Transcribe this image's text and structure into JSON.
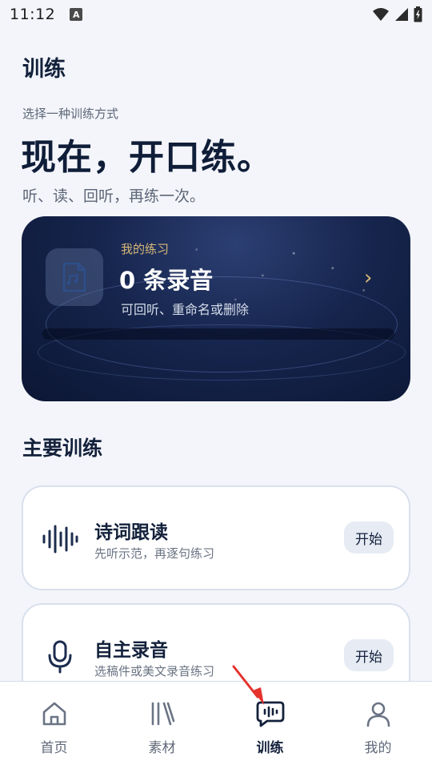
{
  "status": {
    "time": "11:12",
    "badge": "A"
  },
  "page": {
    "title": "训练",
    "subtitle": "选择一种训练方式",
    "headline": "现在，开口练。",
    "tagline": "听、读、回听，再练一次。"
  },
  "practice_card": {
    "label": "我的练习",
    "count": "0 条录音",
    "description": "可回听、重命名或删除",
    "chevron": "›"
  },
  "section": {
    "title": "主要训练"
  },
  "trainings": [
    {
      "title": "诗词跟读",
      "description": "先听示范，再逐句练习",
      "button": "开始",
      "icon": "waveform-icon"
    },
    {
      "title": "自主录音",
      "description": "选稿件或美文录音练习",
      "button": "开始",
      "icon": "microphone-icon"
    }
  ],
  "nav": [
    {
      "label": "首页",
      "icon": "home-icon",
      "active": false
    },
    {
      "label": "素材",
      "icon": "books-icon",
      "active": false
    },
    {
      "label": "训练",
      "icon": "voice-chat-icon",
      "active": true
    },
    {
      "label": "我的",
      "icon": "person-icon",
      "active": false
    }
  ],
  "colors": {
    "background": "#f3f5fa",
    "text_primary": "#13213b",
    "card_dark": "#16254d",
    "accent_gold": "#d8b877",
    "annotation_red": "#e5322d"
  }
}
